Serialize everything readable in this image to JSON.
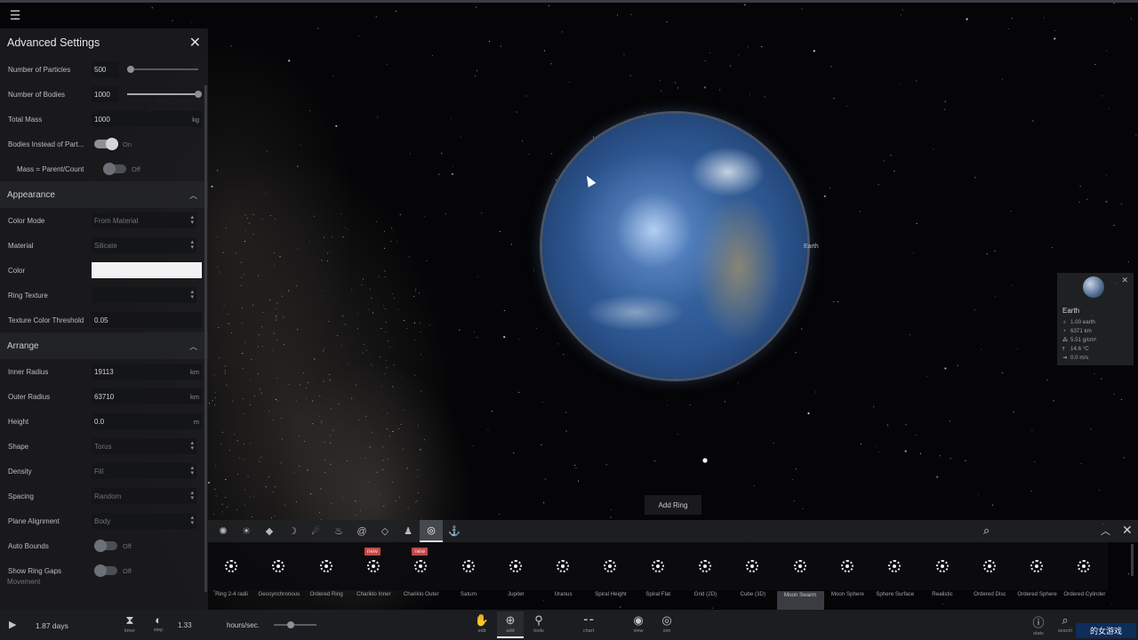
{
  "panel": {
    "title": "Advanced Settings",
    "rows_top": [
      {
        "label": "Number of Particles",
        "value": "500",
        "slider": 0.05
      },
      {
        "label": "Number of Bodies",
        "value": "1000",
        "slider": 1.0
      },
      {
        "label": "Total Mass",
        "value": "1000",
        "unit": "kg"
      },
      {
        "label": "Bodies Instead of Part...",
        "toggle": "On"
      },
      {
        "label": "Mass = Parent/Count",
        "toggle": "Off"
      }
    ],
    "appearance": {
      "title": "Appearance",
      "color_mode": {
        "label": "Color Mode",
        "value": "From Material"
      },
      "material": {
        "label": "Material",
        "value": "Silicate"
      },
      "color": {
        "label": "Color",
        "value": "#f2f2f2"
      },
      "ring_texture": {
        "label": "Ring Texture",
        "value": ""
      },
      "threshold": {
        "label": "Texture Color Threshold",
        "value": "0.05"
      }
    },
    "arrange": {
      "title": "Arrange",
      "inner_radius": {
        "label": "Inner Radius",
        "value": "19113",
        "unit": "km"
      },
      "outer_radius": {
        "label": "Outer Radius",
        "value": "63710",
        "unit": "km"
      },
      "height": {
        "label": "Height",
        "value": "0.0",
        "unit": "m"
      },
      "shape": {
        "label": "Shape",
        "value": "Torus"
      },
      "density": {
        "label": "Density",
        "value": "Fill"
      },
      "spacing": {
        "label": "Spacing",
        "value": "Random"
      },
      "plane_alignment": {
        "label": "Plane Alignment",
        "value": "Body"
      },
      "auto_bounds": {
        "label": "Auto Bounds",
        "toggle": "Off"
      },
      "show_ring_gaps": {
        "label": "Show Ring Gaps",
        "toggle": "Off"
      }
    },
    "more": "Movement"
  },
  "viewport": {
    "planet_label": "Earth",
    "add_ring_label": "Add Ring"
  },
  "tool_icons": [
    "sparkle-icon",
    "star-icon",
    "asteroid-icon",
    "moon-icon",
    "comet-icon",
    "teapot-icon",
    "spiral-icon",
    "cube-icon",
    "person-icon",
    "ring-icon",
    "anchor-icon"
  ],
  "tool_glyphs": [
    "✺",
    "☀",
    "◆",
    "☽",
    "☄",
    "♨",
    "@",
    "◇",
    "♟",
    "◎",
    "⚓"
  ],
  "presets": [
    {
      "label": "Ring 2-4 radii"
    },
    {
      "label": "Geosynchronous"
    },
    {
      "label": "Ordered Ring"
    },
    {
      "label": "Chariklo Inner",
      "badge": "new"
    },
    {
      "label": "Chariklo Outer",
      "badge": "new"
    },
    {
      "label": "Saturn"
    },
    {
      "label": "Jupiter"
    },
    {
      "label": "Uranus"
    },
    {
      "label": "Spiral Height"
    },
    {
      "label": "Spiral Flat"
    },
    {
      "label": "Grid (2D)"
    },
    {
      "label": "Cube (3D)"
    },
    {
      "label": "Moon Swarm",
      "selected": true
    },
    {
      "label": "Moon Sphere"
    },
    {
      "label": "Sphere Surface"
    },
    {
      "label": "Realistic"
    },
    {
      "label": "Ordered Disc"
    },
    {
      "label": "Ordered Sphere"
    },
    {
      "label": "Ordered Cylinder"
    }
  ],
  "info_card": {
    "name": "Earth",
    "lines": [
      "1.00 earth",
      "6371 km",
      "5.51 g/cm³",
      "14.6 °C",
      "0.0 m/s"
    ]
  },
  "bottom": {
    "time": "1.87 days",
    "timer": "timer",
    "step": "step",
    "speed_value": "1.33",
    "speed_unit": "hours/sec.",
    "speed_slider": 0.4,
    "tabs": [
      "edit",
      "add",
      "tools",
      "chart",
      "view",
      "sim"
    ],
    "stats": "stats",
    "search": "search",
    "watermark": "的女游戏"
  }
}
